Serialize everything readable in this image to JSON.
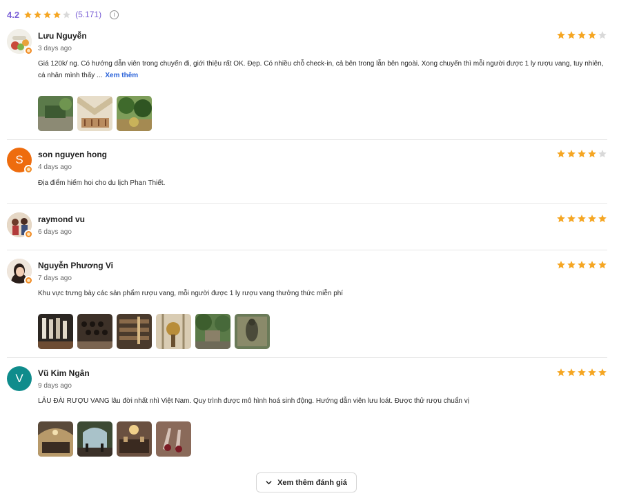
{
  "summary": {
    "rating": "4.2",
    "stars": 4,
    "count": "(5.171)",
    "info_icon": "info-icon"
  },
  "colors": {
    "star_filled": "#f5a623",
    "star_empty": "#d9d9d9",
    "accent": "#7b61d6",
    "link": "#2b63d9"
  },
  "reviews": [
    {
      "name": "Lưu Nguyễn",
      "time": "3 days ago",
      "stars": 4,
      "text": "Giá 120k/ ng. Có hướng dẫn viên trong chuyến đi, giới thiệu rất OK. Đẹp. Có nhiều chỗ check-in, cả bên trong lẫn bên ngoài. Xong chuyến thì mỗi người được 1 ly rượu vang, tuy nhiên, cá nhân mình thấy ...",
      "more": "Xem thêm",
      "avatar": "photo"
    },
    {
      "name": "son nguyen hong",
      "time": "4 days ago",
      "stars": 4,
      "text": "Địa điểm hiếm hoi cho du lịch Phan Thiết.",
      "avatar_letter": "S",
      "avatar_color": "#ee6c0e"
    },
    {
      "name": "raymond vu",
      "time": "6 days ago",
      "stars": 5,
      "avatar": "photo"
    },
    {
      "name": "Nguyễn Phương Vi",
      "time": "7 days ago",
      "stars": 5,
      "text": "Khu vực trưng bày các sản phẩm rượu vang, mỗi người được 1 ly rượu vang thưởng thức miễn phí",
      "avatar": "photo"
    },
    {
      "name": "Vũ Kim Ngân",
      "time": "9 days ago",
      "stars": 5,
      "text": "LÂU ĐÀI RƯỢU VANG lâu đời nhất nhì Việt Nam. Quy trình được mô hình hoá sinh động. Hướng dẫn viên lưu loát. Được thử rượu chuẩn vị",
      "avatar_letter": "V",
      "avatar_color": "#0f8c8c"
    }
  ],
  "load_more": {
    "label": "Xem thêm đánh giá",
    "icon": "chevron-down-icon"
  }
}
